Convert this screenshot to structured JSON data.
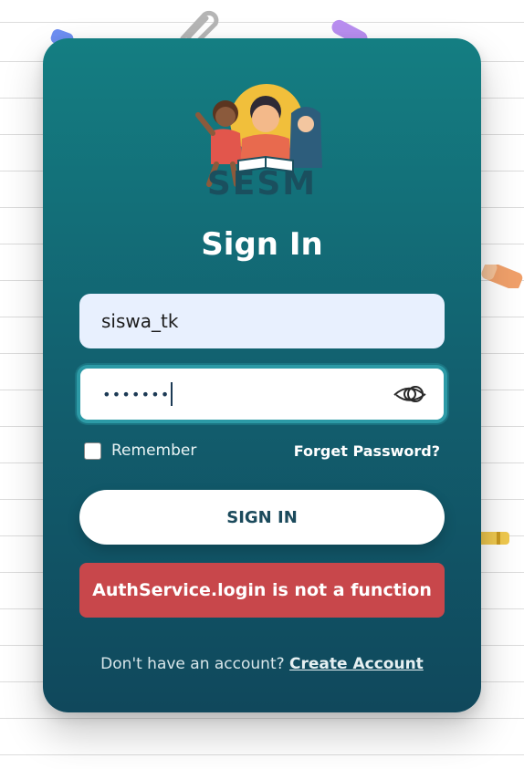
{
  "logo": {
    "text": "SESM"
  },
  "form": {
    "title": "Sign In",
    "username_value": "siswa_tk",
    "password_mask": "•••••••",
    "remember_label": "Remember",
    "forget_link": "Forget Password?",
    "signin_button": "SIGN IN"
  },
  "error": {
    "message": "AuthService.login is not a function"
  },
  "footer": {
    "prompt": "Don't have an account?",
    "link": "Create Account"
  },
  "icons": {
    "show_password": "eye-icon",
    "logo": "children-reading-illustration"
  },
  "colors": {
    "card_top": "#147e82",
    "card_bottom": "#10485c",
    "error": "#c8474b",
    "input_bg": "#e8f0fe",
    "focus_border": "#2c9aa6"
  }
}
